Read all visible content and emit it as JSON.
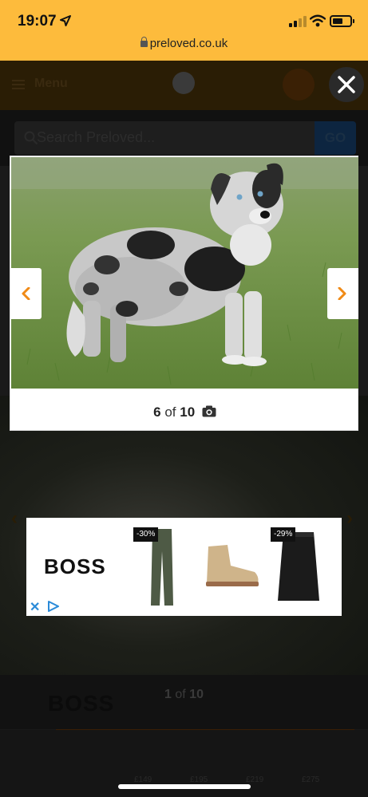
{
  "status_bar": {
    "time": "19:07",
    "url": "preloved.co.uk"
  },
  "site": {
    "menu_label": "Menu",
    "search_placeholder": "Search Preloved...",
    "search_button": "GO",
    "bg_counter_current": "1",
    "bg_counter_of": "of",
    "bg_counter_total": "10",
    "bg_ad_brand": "BOSS",
    "bg_ad_prices": [
      "£149",
      "£195",
      "£219",
      "£275"
    ]
  },
  "lightbox": {
    "counter_current": "6",
    "counter_of": "of",
    "counter_total": "10",
    "icons": {
      "prev": "chevron-left-icon",
      "next": "chevron-right-icon",
      "close": "close-icon",
      "camera": "camera-icon"
    },
    "accent": "#f08a16"
  },
  "ad": {
    "brand": "BOSS",
    "badges": [
      "-30%",
      "-29%"
    ]
  },
  "colors": {
    "status_bar": "#fdbb3c",
    "accent": "#f08a16"
  }
}
